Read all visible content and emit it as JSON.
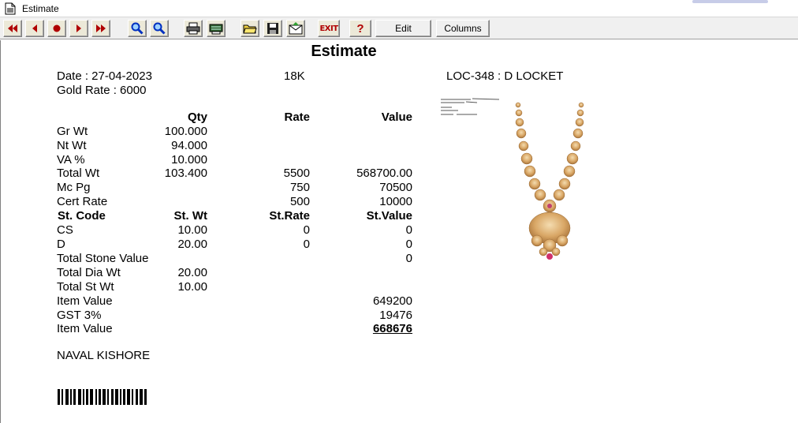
{
  "window": {
    "title": "Estimate"
  },
  "toolbar": {
    "buttons": [
      {
        "icon": "first-record-icon"
      },
      {
        "icon": "previous-record-icon"
      },
      {
        "icon": "stop-icon"
      },
      {
        "icon": "next-record-icon"
      },
      {
        "icon": "last-record-icon"
      },
      {
        "icon": "zoom-in-icon"
      },
      {
        "icon": "zoom-out-icon"
      },
      {
        "icon": "print-icon"
      },
      {
        "icon": "print-setup-icon"
      },
      {
        "icon": "open-folder-icon"
      },
      {
        "icon": "save-icon"
      },
      {
        "icon": "email-icon"
      },
      {
        "icon": "exit-icon"
      },
      {
        "icon": "help-icon"
      }
    ],
    "exit_label": "EXIT",
    "help_label": "?",
    "edit_label": "Edit",
    "columns_label": "Columns"
  },
  "report": {
    "title": "Estimate",
    "date": "Date : 27-04-2023",
    "gold_rate": "Gold Rate : 6000",
    "karat": "18K",
    "item_code": "LOC-348 : D LOCKET",
    "headers": {
      "qty": "Qty",
      "rate": "Rate",
      "value": "Value"
    },
    "rows": [
      {
        "label": "Gr Wt",
        "qty": "100.000",
        "rate": "",
        "value": ""
      },
      {
        "label": "Nt Wt",
        "qty": "94.000",
        "rate": "",
        "value": ""
      },
      {
        "label": "VA %",
        "qty": "10.000",
        "rate": "",
        "value": ""
      },
      {
        "label": "Total Wt",
        "qty": "103.400",
        "rate": "5500",
        "value": "568700.00"
      },
      {
        "label": "Mc Pg",
        "qty": "",
        "rate": "750",
        "value": "70500"
      },
      {
        "label": "Cert Rate",
        "qty": "",
        "rate": "500",
        "value": "10000"
      }
    ],
    "stone_headers": {
      "code": "St. Code",
      "wt": "St. Wt",
      "rate": "St.Rate",
      "value": "St.Value"
    },
    "stones": [
      {
        "code": "CS",
        "wt": "10.00",
        "rate": "0",
        "value": "0"
      },
      {
        "code": "D",
        "wt": "20.00",
        "rate": "0",
        "value": "0"
      }
    ],
    "total_stone_value": {
      "label": "Total Stone Value",
      "value": "0"
    },
    "total_dia_wt": {
      "label": "Total Dia Wt",
      "value": "20.00"
    },
    "total_st_wt": {
      "label": "Total St Wt",
      "value": "10.00"
    },
    "item_value": {
      "label": "Item Value",
      "value": "649200"
    },
    "gst": {
      "label": "GST 3%",
      "value": "19476"
    },
    "final_value": {
      "label": "Item Value",
      "value": "668676"
    },
    "customer": "NAVAL KISHORE"
  }
}
